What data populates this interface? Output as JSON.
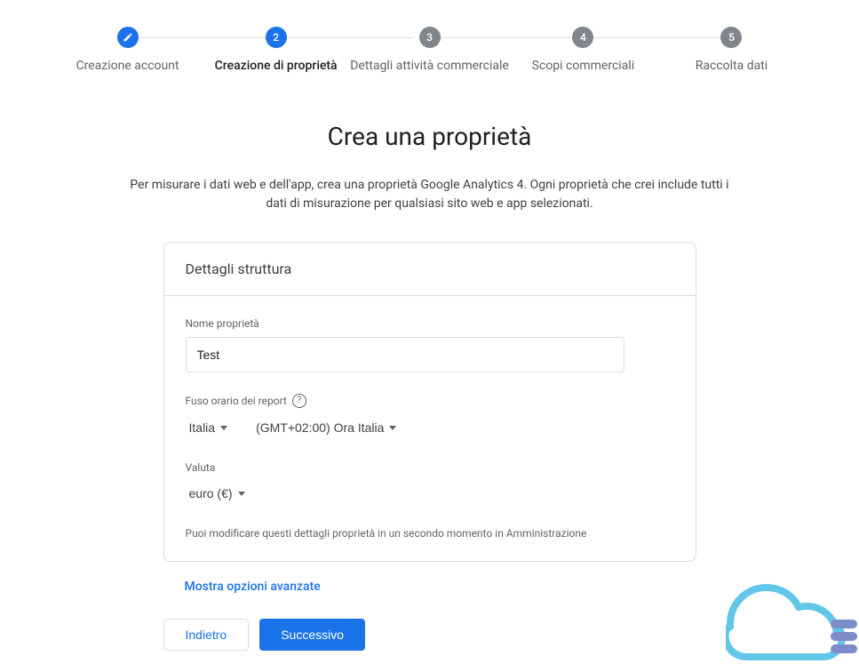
{
  "stepper": {
    "steps": [
      {
        "label": "Creazione account",
        "state": "completed"
      },
      {
        "label": "Creazione di proprietà",
        "number": "2",
        "state": "active"
      },
      {
        "label": "Dettagli attività commerciale",
        "number": "3",
        "state": "pending"
      },
      {
        "label": "Scopi commerciali",
        "number": "4",
        "state": "pending"
      },
      {
        "label": "Raccolta dati",
        "number": "5",
        "state": "pending"
      }
    ]
  },
  "page": {
    "title": "Crea una proprietà",
    "subtitle": "Per misurare i dati web e dell'app, crea una proprietà Google Analytics 4. Ogni proprietà che crei include tutti i dati di misurazione per qualsiasi sito web e app selezionati."
  },
  "card": {
    "header": "Dettagli struttura",
    "property_name": {
      "label": "Nome proprietà",
      "value": "Test"
    },
    "timezone": {
      "label": "Fuso orario dei report",
      "country": "Italia",
      "tz": "(GMT+02:00) Ora Italia"
    },
    "currency": {
      "label": "Valuta",
      "value": "euro (€)"
    },
    "note": "Puoi modificare questi dettagli proprietà in un secondo momento in Amministrazione"
  },
  "advanced_link": "Mostra opzioni avanzate",
  "buttons": {
    "back": "Indietro",
    "next": "Successivo"
  }
}
